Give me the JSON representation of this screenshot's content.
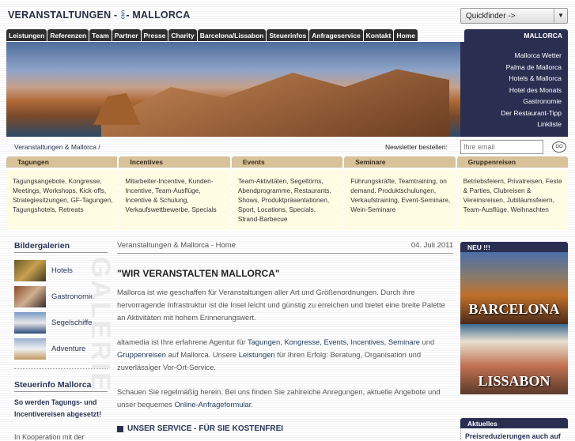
{
  "logo": {
    "left": "VERANSTALTUNGEN -",
    "und": "UND",
    "right": "- MALLORCA"
  },
  "quickfinder": {
    "label": "Quickfinder ->"
  },
  "nav": [
    "Leistungen",
    "Referenzen",
    "Team",
    "Partner",
    "Presse",
    "Charity",
    "Barcelona/Lissabon",
    "Steuerinfos",
    "Anfrageservice",
    "Kontakt",
    "Home"
  ],
  "nav_right": "MALLORCA",
  "side_links": [
    "Mallorca Wetter",
    "Palma de Mallorca",
    "Hotels & Mallorca",
    "Hotel des Monats",
    "Gastronomie",
    "Der Restaurant-Tipp",
    "Linkliste"
  ],
  "breadcrumb": "Veranstaltungen & Mallorca /",
  "newsletter": {
    "label": "Newsletter bestellen:",
    "placeholder": "Ihre email",
    "go": "GO"
  },
  "categories": [
    {
      "title": "Tagungen",
      "text": "Tagungsangebote, Kongresse, Meetings, Workshops, Kick-offs, Strategiesitzungen, GF-Tagungen, Tagungshotels, Retreats"
    },
    {
      "title": "Incentives",
      "text": "Mitarbeiter-Incentive, Kunden-Incentive, Team-Ausflüge, Incentive & Schulung, Verkaufswettbewerbe, Specials"
    },
    {
      "title": "Events",
      "text": "Team-Aktivitäten, Segeltörns, Abendprogramme, Restaurants, Shows, Produktpräsentationen, Sport, Locations, Specials, Strand-Barbecue"
    },
    {
      "title": "Seminare",
      "text": "Führungskräfte, Teamtraining, on demand, Produktschulungen, Verkaufstraining, Event-Seminare, Wein-Seminare"
    },
    {
      "title": "Gruppenreisen",
      "text": "Betriebsfeiern, Privatreisen, Feste & Parties, Clubreisen & Vereinsreisen, Jubiläumsfeiern, Team-Ausflüge, Weihnachten"
    }
  ],
  "left": {
    "gallery_title": "Bildergalerien",
    "galerie_watermark": "GALERIE",
    "galleries": [
      "Hotels",
      "Gastronomie",
      "Segelschiffe",
      "Adventure"
    ],
    "steuer_title": "Steuerinfo Mallorca",
    "steuer_link": "So werden Tagungs- und Incentivereisen abgesetzt!",
    "koop": "In Kooperation mit der"
  },
  "main": {
    "crumb": "Veranstaltungen & Mallorca - Home",
    "date": "04. Juli 2011",
    "heading": "\"WIR VERANSTALTEN MALLORCA\"",
    "p1": "Mallorca ist wie geschaffen für Veranstaltungen aller Art und Größenordnungen. Durch ihre hervorragende Infrastruktur ist die Insel leicht und günstig zu erreichen und bietet eine breite Palette an Aktivitäten mit hohem Erinnerungswert.",
    "p2a": "altamedia ist Ihre erfahrene Agentur für ",
    "l_tagungen": "Tagungen",
    "c1": ", ",
    "l_kongresse": "Kongresse",
    "c2": ", ",
    "l_events": "Events",
    "c3": ", ",
    "l_incentives": "Incentives",
    "c4": ", ",
    "l_seminare": "Seminare",
    "p2b": " und ",
    "l_gruppen": "Gruppenreisen",
    "p2c": " auf Mallorca. Unsere ",
    "l_leistungen": "Leistungen",
    "p2d": " für Ihren Erfolg: Beratung, Organisation und zuverlässiger Vor-Ort-Service.",
    "p3a": "Schauen Sie regelmäßig herein. Bei uns finden Sie zahlreiche Anregungen, aktuelle Angebote und unser bequemes ",
    "l_formular": "Online-Anfrageformular",
    "p3b": ".",
    "service": "UNSER SERVICE - FÜR SIE KOSTENFREI"
  },
  "right": {
    "neu": "NEU !!!",
    "barcelona": "BARCELONA",
    "lissabon": "LISSABON",
    "aktuelles": "Aktuelles",
    "news1": "Preisreduzierungen auch auf"
  }
}
